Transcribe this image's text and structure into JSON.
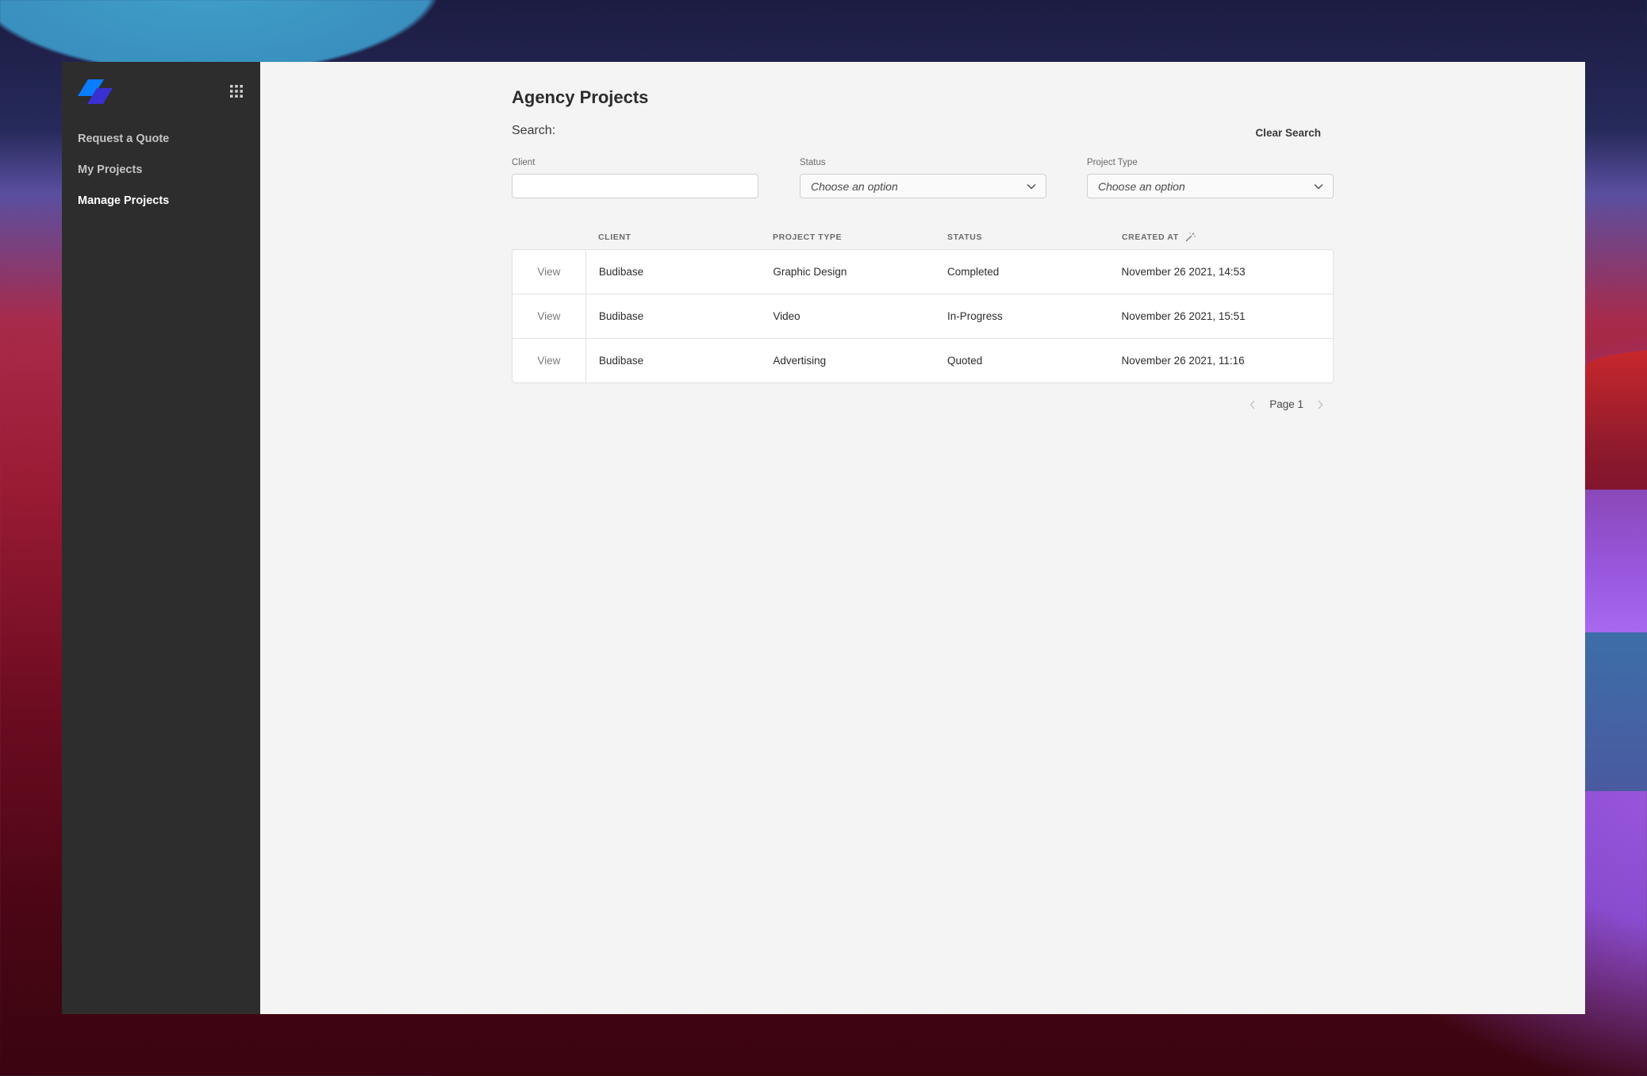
{
  "sidebar": {
    "logo": "budibase-logo",
    "apps_icon": "grid-icon",
    "items": [
      {
        "label": "Request a Quote",
        "active": false
      },
      {
        "label": "My Projects",
        "active": false
      },
      {
        "label": "Manage Projects",
        "active": true
      }
    ]
  },
  "main": {
    "title": "Agency Projects",
    "search_label": "Search:",
    "clear_search_label": "Clear Search",
    "filters": {
      "client": {
        "label": "Client",
        "value": "",
        "placeholder": ""
      },
      "status": {
        "label": "Status",
        "placeholder": "Choose an option"
      },
      "project_type": {
        "label": "Project Type",
        "placeholder": "Choose an option"
      }
    },
    "table": {
      "columns": [
        "",
        "Client",
        "Project Type",
        "Status",
        "Created At"
      ],
      "sort_icon": "magic-wand-icon",
      "rows": [
        {
          "action": "View",
          "client": "Budibase",
          "project_type": "Graphic Design",
          "status": "Completed",
          "created_at": "November 26 2021, 14:53"
        },
        {
          "action": "View",
          "client": "Budibase",
          "project_type": "Video",
          "status": "In-Progress",
          "created_at": "November 26 2021, 15:51"
        },
        {
          "action": "View",
          "client": "Budibase",
          "project_type": "Advertising",
          "status": "Quoted",
          "created_at": "November 26 2021, 11:16"
        }
      ]
    },
    "pagination": {
      "label": "Page 1"
    }
  },
  "colors": {
    "sidebar_bg": "#2d2d2d",
    "main_bg": "#f4f4f4",
    "logo_primary": "#0a7cff",
    "logo_secondary": "#3a2fd0"
  }
}
